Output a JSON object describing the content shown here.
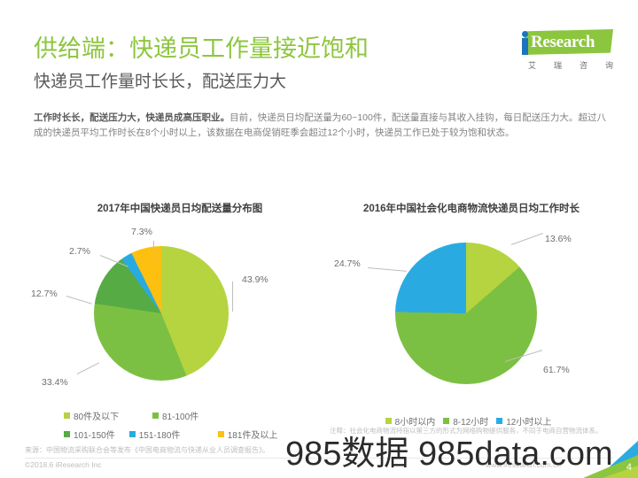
{
  "header": {
    "title": "供给端：快递员工作量接近饱和",
    "subtitle": "快递员工作量时长长，配送压力大",
    "logo": {
      "word": "Research",
      "cn": [
        "艾",
        "瑞",
        "咨",
        "询"
      ]
    }
  },
  "body": {
    "lead": "工作时长长，配送压力大，快递员成高压职业。",
    "rest": "目前，快递员日均配送量为60~100件，配送量直接与其收入挂钩，每日配送压力大。超过八成的快递员平均工作时长在8个小时以上，该数据在电商促销旺季会超过12个小时，快递员工作已处于较为饱和状态。"
  },
  "chart_data": [
    {
      "type": "pie",
      "id": "delivery-volume",
      "title": "2017年中国快递员日均配送量分布图",
      "categories": [
        "80件及以下",
        "81-100件",
        "101-150件",
        "151-180件",
        "181件及以上"
      ],
      "values": [
        43.9,
        33.4,
        12.7,
        2.7,
        7.3
      ],
      "labels": [
        "43.9%",
        "33.4%",
        "12.7%",
        "2.7%",
        "7.3%"
      ],
      "colors": [
        "#b5d43f",
        "#7cc043",
        "#57ab45",
        "#29abe2",
        "#fdc010"
      ],
      "legend_position": "bottom",
      "unit": "%"
    },
    {
      "type": "pie",
      "id": "work-hours",
      "title": "2016年中国社会化电商物流快递员日均工作时长",
      "categories": [
        "8小时以内",
        "8-12小时",
        "12小时以上"
      ],
      "values": [
        13.6,
        61.7,
        24.7
      ],
      "labels": [
        "13.6%",
        "61.7%",
        "24.7%"
      ],
      "colors": [
        "#b5d43f",
        "#7cc043",
        "#29abe2"
      ],
      "legend_position": "bottom",
      "unit": "%"
    }
  ],
  "note": "注释：社会化电商物流特指以第三方的形式为网络购物提供服务，不同于电商自营物流体系。",
  "source": "来源：中国物流采购联合会等发布《中国电商物流与快递从业人员调查报告》。",
  "footer": {
    "copyright": "©2018.6 iResearch Inc",
    "url": "www.iresearch.com.cn",
    "page": "4"
  },
  "watermark": {
    "text": "985数据 985data.com"
  }
}
